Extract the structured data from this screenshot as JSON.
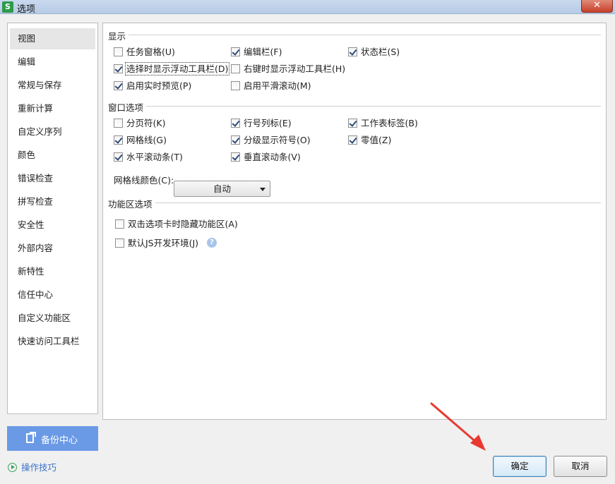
{
  "window": {
    "title": "选项",
    "app_icon_letter": "S",
    "close_glyph": "✕"
  },
  "nav": {
    "items": [
      {
        "label": "视图",
        "selected": true
      },
      {
        "label": "编辑"
      },
      {
        "label": "常规与保存"
      },
      {
        "label": "重新计算"
      },
      {
        "label": "自定义序列"
      },
      {
        "label": "颜色"
      },
      {
        "label": "错误检查"
      },
      {
        "label": "拼写检查"
      },
      {
        "label": "安全性"
      },
      {
        "label": "外部内容"
      },
      {
        "label": "新特性"
      },
      {
        "label": "信任中心"
      },
      {
        "label": "自定义功能区"
      },
      {
        "label": "快速访问工具栏"
      }
    ],
    "backup_label": "备份中心",
    "tips_label": "操作技巧"
  },
  "display": {
    "title": "显示",
    "options": [
      {
        "label": "任务窗格(U)",
        "checked": false
      },
      {
        "label": "编辑栏(F)",
        "checked": true
      },
      {
        "label": "状态栏(S)",
        "checked": true
      },
      {
        "label": "选择时显示浮动工具栏(D)",
        "checked": true,
        "focused": true
      },
      {
        "label": "右键时显示浮动工具栏(H)",
        "checked": false
      },
      {
        "label": "启用实时预览(P)",
        "checked": true
      },
      {
        "label": "启用平滑滚动(M)",
        "checked": false
      }
    ]
  },
  "window_options": {
    "title": "窗口选项",
    "options": [
      {
        "label": "分页符(K)",
        "checked": false
      },
      {
        "label": "行号列标(E)",
        "checked": true
      },
      {
        "label": "工作表标签(B)",
        "checked": true
      },
      {
        "label": "网格线(G)",
        "checked": true
      },
      {
        "label": "分级显示符号(O)",
        "checked": true
      },
      {
        "label": "零值(Z)",
        "checked": true
      },
      {
        "label": "水平滚动条(T)",
        "checked": true
      },
      {
        "label": "垂直滚动条(V)",
        "checked": true
      }
    ],
    "grid_color_label": "网格线颜色(C):",
    "grid_color_value": "自动"
  },
  "ribbon": {
    "title": "功能区选项",
    "options": [
      {
        "label": "双击选项卡时隐藏功能区(A)",
        "checked": false
      },
      {
        "label": "默认JS开发环境(J)",
        "checked": false
      }
    ],
    "help_glyph": "?"
  },
  "buttons": {
    "ok": "确定",
    "cancel": "取消"
  },
  "colors": {
    "accent": "#6a9ae6",
    "annotation_arrow": "#e8392f"
  }
}
